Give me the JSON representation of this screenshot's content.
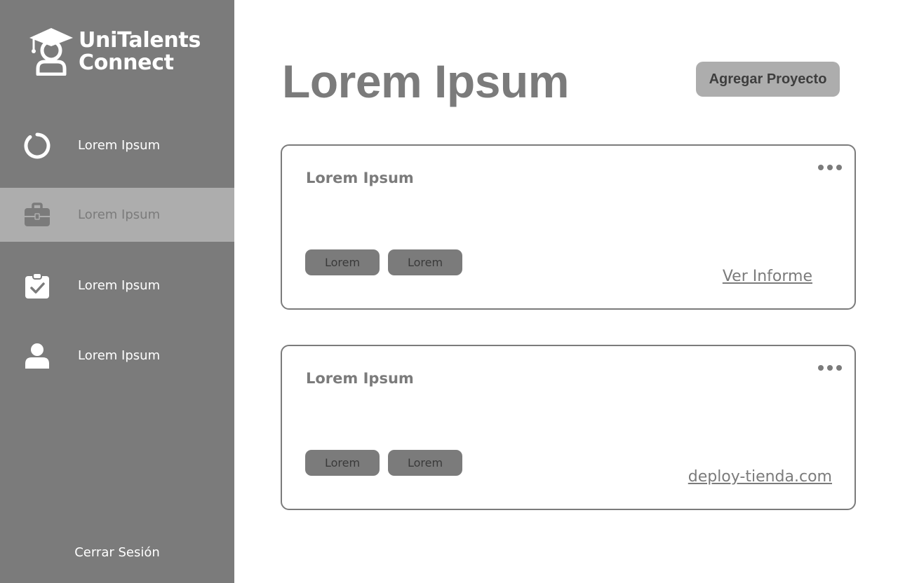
{
  "brand": {
    "line1": "UniTalents",
    "line2": "Connect"
  },
  "sidebar": {
    "items": [
      {
        "label": "Lorem Ipsum",
        "icon": "circle-progress-icon",
        "active": false
      },
      {
        "label": "Lorem Ipsum",
        "icon": "briefcase-icon",
        "active": true
      },
      {
        "label": "Lorem Ipsum",
        "icon": "clipboard-check-icon",
        "active": false
      },
      {
        "label": "Lorem Ipsum",
        "icon": "user-icon",
        "active": false
      }
    ],
    "logout_label": "Cerrar Sesión"
  },
  "main": {
    "title": "Lorem Ipsum",
    "add_button_label": "Agregar Proyecto",
    "cards": [
      {
        "title": "Lorem Ipsum",
        "tags": [
          "Lorem",
          "Lorem"
        ],
        "link": "Ver Informe"
      },
      {
        "title": "Lorem Ipsum",
        "tags": [
          "Lorem",
          "Lorem"
        ],
        "link": "deploy-tienda.com"
      }
    ]
  },
  "colors": {
    "sidebar_bg": "#7b7b7b",
    "active_item_bg": "#adadad",
    "text_gray": "#7b7b7b",
    "button_bg": "#adadad"
  }
}
